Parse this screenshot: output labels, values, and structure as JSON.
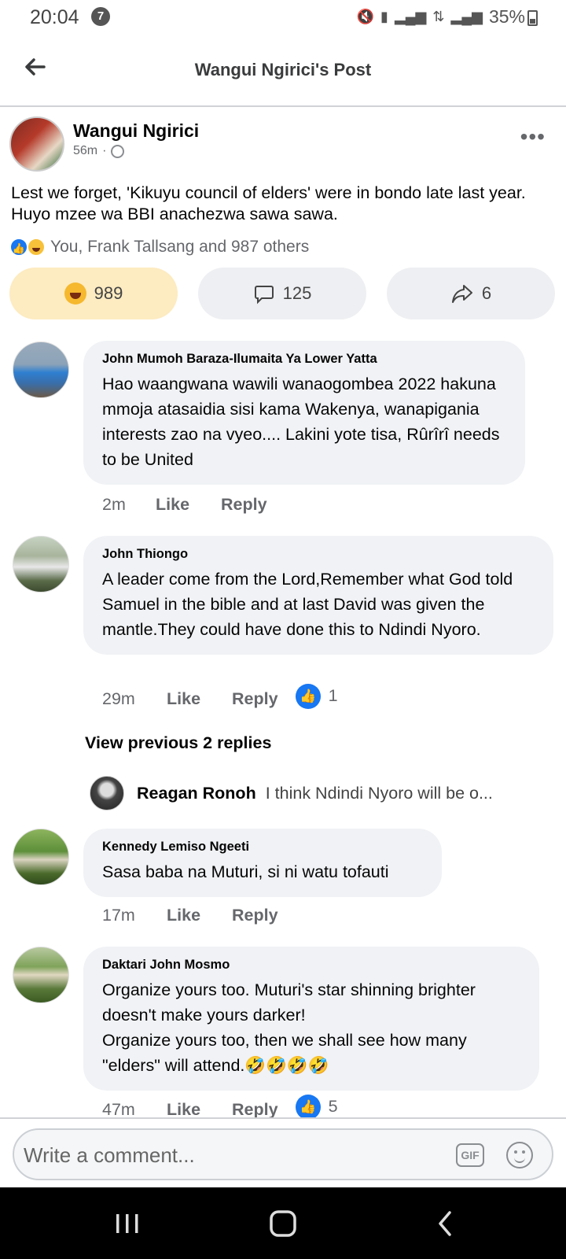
{
  "status": {
    "time": "20:04",
    "notification_count": "7",
    "battery": "35%"
  },
  "header": {
    "title": "Wangui Ngirici's Post"
  },
  "post": {
    "author": "Wangui Ngirici",
    "time": "56m",
    "separator": "·",
    "text": "Lest we forget, 'Kikuyu council of elders' were in bondo late last year. Huyo mzee wa BBI anachezwa sawa sawa.",
    "reactions_summary": "You, Frank Tallsang and 987 others",
    "reaction_count": "989",
    "comment_count": "125",
    "share_count": "6"
  },
  "comments": [
    {
      "name": "John Mumoh Baraza-Ilumaita Ya Lower Yatta",
      "text": "Hao waangwana wawili wanaogombea 2022 hakuna mmoja atasaidia sisi kama Wakenya, wanapigania interests zao na vyeo.... Lakini yote tisa, Rûrîrî needs to be United",
      "time": "2m",
      "like": "Like",
      "reply": "Reply"
    },
    {
      "name": "John Thiongo",
      "text": "A leader come from the Lord,Remember what God told Samuel in the bible and at last David was given the mantle.They could have done this to Ndindi Nyoro.",
      "time": "29m",
      "like": "Like",
      "reply": "Reply",
      "likes": "1"
    },
    {
      "name": "Kennedy Lemiso Ngeeti",
      "text": "Sasa baba na Muturi, si ni watu tofauti",
      "time": "17m",
      "like": "Like",
      "reply": "Reply"
    },
    {
      "name": "Daktari John Mosmo",
      "text": "Organize yours too. Muturi's star shinning brighter doesn't make yours darker!\nOrganize yours too, then we shall see how many \"elders\" will attend.🤣🤣🤣🤣",
      "time": "47m",
      "like": "Like",
      "reply": "Reply",
      "likes": "5"
    }
  ],
  "replies": {
    "view_previous": "View previous 2 replies",
    "latest_name": "Reagan Ronoh",
    "latest_text": "I think Ndindi Nyoro will be o..."
  },
  "composer": {
    "placeholder": "Write a comment...",
    "gif_label": "GIF"
  },
  "colors": {
    "accent": "#1877f2",
    "haha_active_bg": "#fdebc1",
    "bubble_bg": "#f0f2f5"
  }
}
